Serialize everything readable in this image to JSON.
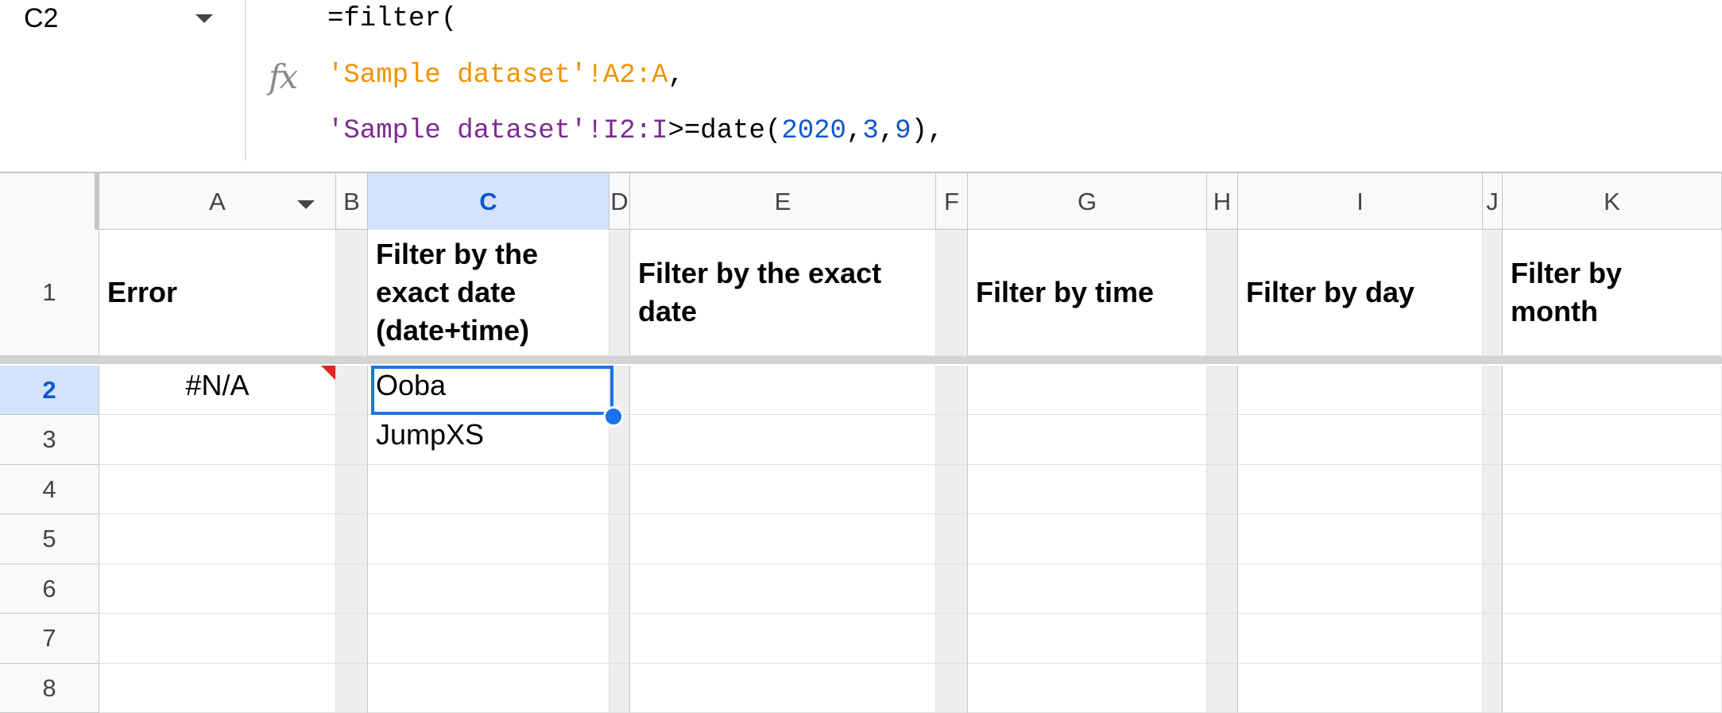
{
  "name_box": {
    "value": "C2"
  },
  "formula": {
    "line1": [
      {
        "text": "=filter(",
        "color": "black"
      }
    ],
    "line2": [
      {
        "text": "'Sample dataset'!A2:A",
        "color": "orange"
      },
      {
        "text": ",",
        "color": "black"
      }
    ],
    "line3": [
      {
        "text": "'Sample dataset'!I2:I",
        "color": "purple"
      },
      {
        "text": ">=date(",
        "color": "black"
      },
      {
        "text": "2020",
        "color": "blue"
      },
      {
        "text": ",",
        "color": "black"
      },
      {
        "text": "3",
        "color": "blue"
      },
      {
        "text": ",",
        "color": "black"
      },
      {
        "text": "9",
        "color": "blue"
      },
      {
        "text": "),",
        "color": "black"
      }
    ]
  },
  "columns": [
    "A",
    "B",
    "C",
    "D",
    "E",
    "F",
    "G",
    "H",
    "I",
    "J",
    "K"
  ],
  "selected_column": "C",
  "rows": [
    "1",
    "2",
    "3",
    "4",
    "5",
    "6",
    "7",
    "8"
  ],
  "selected_row": "2",
  "headers": {
    "A": "Error",
    "C": "Filter by the exact date (date+time)",
    "E": "Filter by the exact date",
    "G": "Filter by time",
    "I": "Filter by day",
    "K": "Filter by month"
  },
  "cells": {
    "A2": "#N/A",
    "C2": "Ooba",
    "C3": "JumpXS"
  },
  "colors": {
    "selection": "#1a73e8",
    "header_selected": "#d3e3fd",
    "error_flag": "#e52521"
  }
}
